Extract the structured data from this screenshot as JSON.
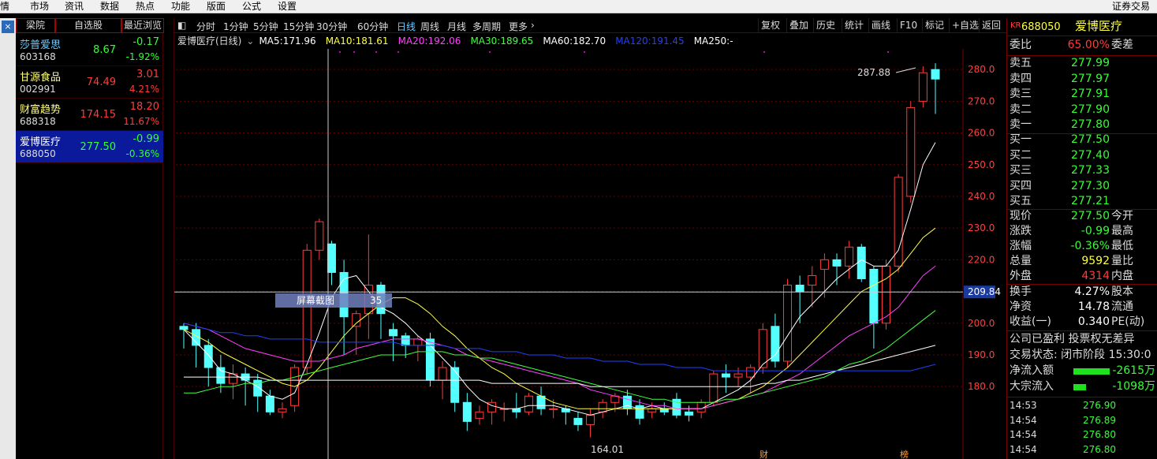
{
  "menu": {
    "items": [
      "情",
      "市场",
      "资讯",
      "数据",
      "热点",
      "功能",
      "版面",
      "公式",
      "设置"
    ],
    "right": "证券交易"
  },
  "watchlist": {
    "tabs": [
      "梁院",
      "自选股",
      "最近浏览"
    ],
    "items": [
      {
        "name": "莎普爱思",
        "code": "603168",
        "price": "8.67",
        "change": "-0.17",
        "pct": "-1.92%",
        "dir": "down"
      },
      {
        "name": "甘源食品",
        "code": "002991",
        "price": "74.49",
        "change": "3.01",
        "pct": "4.21%",
        "dir": "up"
      },
      {
        "name": "财富趋势",
        "code": "688318",
        "price": "174.15",
        "change": "18.20",
        "pct": "11.67%",
        "dir": "up"
      },
      {
        "name": "爱博医疗",
        "code": "688050",
        "price": "277.50",
        "change": "-0.99",
        "pct": "-0.36%",
        "dir": "down"
      }
    ]
  },
  "toolbar": {
    "periods": [
      "分时",
      "1分钟",
      "5分钟",
      "15分钟",
      "30分钟",
      "60分钟",
      "日线",
      "周线",
      "月线",
      "多周期",
      "更多"
    ],
    "active_period": "日线",
    "buttons": [
      "复权",
      "叠加",
      "历史",
      "统计",
      "画线",
      "F10",
      "标记",
      "+自选",
      "返回"
    ]
  },
  "chart": {
    "title": "爱博医疗(日线)",
    "ma": [
      {
        "label": "MA5:",
        "value": "171.96",
        "color": "#ffffff"
      },
      {
        "label": "MA10:",
        "value": "181.61",
        "color": "#ffff40"
      },
      {
        "label": "MA20:",
        "value": "192.06",
        "color": "#ff40ff"
      },
      {
        "label": "MA30:",
        "value": "189.65",
        "color": "#40ff40"
      },
      {
        "label": "MA60:",
        "value": "182.70",
        "color": "#ffffff"
      },
      {
        "label": "MA120:",
        "value": "191.45",
        "color": "#2040ff"
      },
      {
        "label": "MA250:",
        "value": "-",
        "color": "#ffffff"
      }
    ],
    "yticks": [
      "280.0",
      "270.0",
      "260.0",
      "250.0",
      "240.0",
      "230.0",
      "220.0",
      "210.0",
      "200.0",
      "190.0",
      "180.0"
    ],
    "crosshair_price": "209.84",
    "high_label": "287.88",
    "low_label": "164.01",
    "tooltip": {
      "label": "屏幕截图",
      "value": "35"
    },
    "markers": [
      "财",
      "榜"
    ]
  },
  "chart_data": {
    "type": "candlestick",
    "title": "爱博医疗(日线)",
    "ylim": [
      160,
      290
    ],
    "candles": [
      [
        199,
        200,
        192,
        198
      ],
      [
        198,
        200,
        186,
        193
      ],
      [
        193,
        195,
        180,
        186
      ],
      [
        186,
        190,
        178,
        181
      ],
      [
        181,
        187,
        176,
        184
      ],
      [
        184,
        186,
        174,
        182
      ],
      [
        182,
        184,
        172,
        177
      ],
      [
        177,
        179,
        171,
        172
      ],
      [
        172,
        175,
        170,
        173
      ],
      [
        174,
        187,
        172,
        186
      ],
      [
        186,
        225,
        184,
        223
      ],
      [
        223,
        233,
        220,
        232
      ],
      [
        225,
        226,
        212,
        216
      ],
      [
        216,
        220,
        190,
        202
      ],
      [
        199,
        204,
        190,
        203
      ],
      [
        203,
        228,
        195,
        212
      ],
      [
        212,
        213,
        195,
        203
      ],
      [
        198,
        200,
        188,
        196
      ],
      [
        196,
        197,
        189,
        193
      ],
      [
        193,
        196,
        188,
        195
      ],
      [
        195,
        197,
        180,
        182
      ],
      [
        182,
        188,
        176,
        186
      ],
      [
        186,
        188,
        172,
        175
      ],
      [
        175,
        178,
        166,
        169
      ],
      [
        170,
        174,
        168,
        172
      ],
      [
        172,
        176,
        168,
        175
      ],
      [
        173,
        175,
        169,
        173
      ],
      [
        173,
        178,
        170,
        172
      ],
      [
        172,
        178,
        171,
        177
      ],
      [
        177,
        180,
        171,
        173
      ],
      [
        173,
        176,
        170,
        173
      ],
      [
        173,
        174,
        168,
        172
      ],
      [
        170,
        172,
        166,
        168
      ],
      [
        168,
        173,
        164,
        171
      ],
      [
        172,
        176,
        170,
        175
      ],
      [
        175,
        178,
        172,
        177
      ],
      [
        177,
        179,
        171,
        173
      ],
      [
        174,
        176,
        168,
        170
      ],
      [
        172,
        175,
        170,
        173
      ],
      [
        173,
        175,
        171,
        172
      ],
      [
        176,
        178,
        170,
        171
      ],
      [
        172,
        174,
        169,
        171
      ],
      [
        172,
        176,
        170,
        175
      ],
      [
        175,
        185,
        174,
        184
      ],
      [
        184,
        187,
        178,
        183
      ],
      [
        183,
        186,
        180,
        184
      ],
      [
        183,
        187,
        178,
        186
      ],
      [
        186,
        200,
        184,
        198
      ],
      [
        199,
        203,
        186,
        188
      ],
      [
        188,
        214,
        186,
        212
      ],
      [
        212,
        215,
        200,
        210
      ],
      [
        212,
        218,
        205,
        215
      ],
      [
        217,
        222,
        208,
        220
      ],
      [
        220,
        222,
        212,
        218
      ],
      [
        218,
        226,
        214,
        224
      ],
      [
        224,
        225,
        213,
        214
      ],
      [
        217,
        218,
        192,
        200
      ],
      [
        200,
        220,
        198,
        218
      ],
      [
        218,
        247,
        216,
        246
      ],
      [
        240,
        270,
        238,
        268
      ],
      [
        270,
        281,
        268,
        279
      ],
      [
        280,
        282,
        266,
        277
      ]
    ],
    "ma": {
      "MA5": [
        198,
        194,
        190,
        185,
        184,
        182,
        180,
        177,
        176,
        178,
        187,
        197,
        208,
        214,
        215,
        210,
        205,
        203,
        200,
        196,
        193,
        189,
        185,
        180,
        176,
        174,
        173,
        173,
        174,
        174,
        174,
        173,
        172,
        171,
        172,
        173,
        174,
        173,
        174,
        173,
        173,
        173,
        173,
        175,
        177,
        179,
        182,
        187,
        190,
        196,
        202,
        206,
        210,
        214,
        217,
        220,
        218,
        218,
        223,
        236,
        250,
        257
      ],
      "MA10": [
        198,
        196,
        194,
        191,
        189,
        187,
        185,
        183,
        181,
        180,
        182,
        186,
        191,
        196,
        200,
        203,
        206,
        208,
        208,
        206,
        203,
        199,
        196,
        192,
        189,
        186,
        184,
        181,
        179,
        177,
        175,
        174,
        173,
        173,
        173,
        173,
        173,
        173,
        173,
        173,
        173,
        173,
        173,
        174,
        175,
        176,
        178,
        180,
        183,
        186,
        190,
        194,
        198,
        202,
        206,
        210,
        212,
        214,
        217,
        222,
        227,
        230
      ],
      "MA20": [
        200,
        199,
        198,
        196,
        194,
        192,
        191,
        190,
        189,
        188,
        188,
        188,
        189,
        190,
        192,
        193,
        194,
        195,
        195,
        195,
        194,
        193,
        192,
        190,
        189,
        188,
        187,
        186,
        185,
        184,
        183,
        182,
        181,
        179,
        178,
        177,
        176,
        175,
        174,
        174,
        173,
        173,
        173,
        174,
        175,
        176,
        177,
        178,
        180,
        182,
        184,
        187,
        190,
        193,
        196,
        198,
        200,
        202,
        205,
        210,
        215,
        218
      ],
      "MA30": [
        178,
        178,
        179,
        180,
        180,
        181,
        181,
        182,
        182,
        183,
        184,
        185,
        186,
        187,
        188,
        189,
        190,
        190,
        190,
        191,
        191,
        191,
        190,
        190,
        189,
        189,
        188,
        187,
        186,
        185,
        184,
        183,
        182,
        181,
        180,
        179,
        178,
        177,
        176,
        176,
        175,
        175,
        175,
        175,
        176,
        176,
        177,
        178,
        179,
        180,
        181,
        182,
        183,
        185,
        187,
        188,
        190,
        192,
        195,
        198,
        201,
        204
      ],
      "MA60": [
        183,
        183,
        183,
        183,
        183,
        183,
        183,
        182,
        182,
        182,
        182,
        182,
        182,
        182,
        182,
        182,
        182,
        182,
        182,
        182,
        182,
        182,
        182,
        182,
        182,
        181,
        181,
        181,
        181,
        181,
        181,
        181,
        181,
        180,
        180,
        180,
        180,
        180,
        180,
        180,
        180,
        180,
        180,
        180,
        180,
        180,
        180,
        181,
        181,
        182,
        182,
        183,
        184,
        185,
        186,
        187,
        188,
        189,
        190,
        191,
        192,
        193
      ],
      "MA120": [
        200,
        199,
        198,
        197,
        197,
        196,
        196,
        195,
        195,
        195,
        195,
        194,
        194,
        194,
        194,
        194,
        194,
        194,
        193,
        193,
        193,
        193,
        192,
        192,
        192,
        191,
        191,
        191,
        190,
        190,
        190,
        189,
        189,
        189,
        188,
        188,
        188,
        187,
        187,
        187,
        186,
        186,
        186,
        185,
        185,
        185,
        185,
        185,
        185,
        185,
        185,
        185,
        185,
        185,
        185,
        185,
        185,
        185,
        185,
        185,
        186,
        187
      ]
    }
  },
  "quote": {
    "code": "688050",
    "name": "爱博医疗",
    "badge": "KR",
    "weibi_label": "委比",
    "weibi": "65.00%",
    "weicha_label": "委差",
    "asks": [
      {
        "label": "卖五",
        "price": "277.99"
      },
      {
        "label": "卖四",
        "price": "277.97"
      },
      {
        "label": "卖三",
        "price": "277.91"
      },
      {
        "label": "卖二",
        "price": "277.90"
      },
      {
        "label": "卖一",
        "price": "277.80"
      }
    ],
    "bids": [
      {
        "label": "买一",
        "price": "277.50"
      },
      {
        "label": "买二",
        "price": "277.40"
      },
      {
        "label": "买三",
        "price": "277.33"
      },
      {
        "label": "买四",
        "price": "277.30"
      },
      {
        "label": "买五",
        "price": "277.21"
      }
    ],
    "stats": [
      {
        "label": "现价",
        "value": "277.50",
        "cls": "dn",
        "l2": "今开"
      },
      {
        "label": "涨跌",
        "value": "-0.99",
        "cls": "dn",
        "l2": "最高"
      },
      {
        "label": "涨幅",
        "value": "-0.36%",
        "cls": "dn",
        "l2": "最低"
      },
      {
        "label": "总量",
        "value": "9592",
        "cls": "yl",
        "l2": "量比"
      },
      {
        "label": "外盘",
        "value": "4314",
        "cls": "up",
        "l2": "内盘"
      }
    ],
    "stats2": [
      {
        "label": "换手",
        "value": "4.27%",
        "cls": "wh",
        "l2": "股本"
      },
      {
        "label": "净资",
        "value": "14.78",
        "cls": "wh",
        "l2": "流通"
      },
      {
        "label": "收益(一)",
        "value": "0.340",
        "cls": "wh",
        "l2": "PE(动)"
      }
    ],
    "notice1": "公司已盈利 投票权无差异",
    "notice2": "交易状态: 闭市阶段 15:30:0",
    "netflow": {
      "label": "净流入额",
      "value": "-2615万"
    },
    "bigflow": {
      "label": "大宗流入",
      "value": "-1098万"
    },
    "ticks": [
      {
        "time": "14:53",
        "price": "276.90"
      },
      {
        "time": "14:54",
        "price": "276.89"
      },
      {
        "time": "14:54",
        "price": "276.80"
      },
      {
        "time": "14:54",
        "price": "276.80"
      }
    ]
  }
}
